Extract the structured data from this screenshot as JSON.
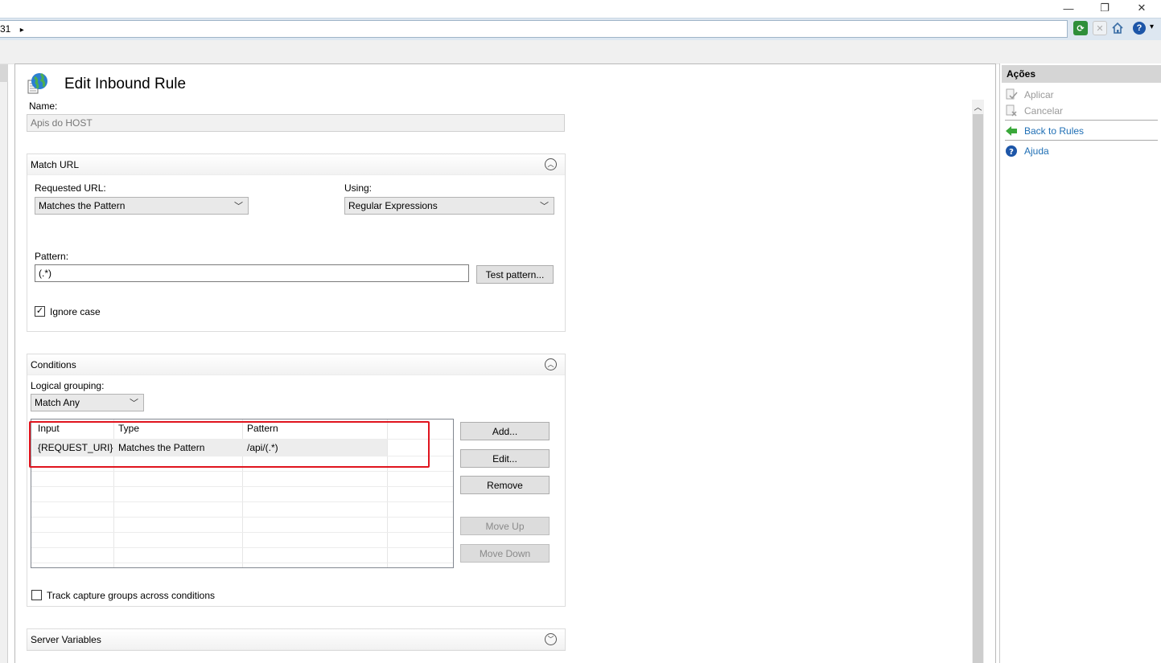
{
  "window": {
    "minimize_glyph": "—",
    "restore_glyph": "❐",
    "close_glyph": "✕"
  },
  "address_bar": {
    "crumb_text": "31",
    "crumb_arrow": "▸"
  },
  "toolbar": {
    "help_menu_arrow": "▾"
  },
  "actions_panel": {
    "title": "Ações",
    "items": [
      {
        "label": "Aplicar",
        "enabled": false
      },
      {
        "label": "Cancelar",
        "enabled": false
      },
      {
        "label": "Back to Rules",
        "enabled": true
      },
      {
        "label": "Ajuda",
        "enabled": true
      }
    ]
  },
  "page": {
    "title": "Edit Inbound Rule"
  },
  "name_field": {
    "label": "Name:",
    "value": "Apis do HOST"
  },
  "match_url": {
    "section_title": "Match URL",
    "requested_url_label": "Requested URL:",
    "requested_url_value": "Matches the Pattern",
    "using_label": "Using:",
    "using_value": "Regular Expressions",
    "pattern_label": "Pattern:",
    "pattern_value": "(.*)",
    "test_pattern_button": "Test pattern...",
    "ignore_case_label": "Ignore case",
    "ignore_case_checked": true
  },
  "conditions": {
    "section_title": "Conditions",
    "logical_grouping_label": "Logical grouping:",
    "logical_grouping_value": "Match Any",
    "columns": [
      "Input",
      "Type",
      "Pattern"
    ],
    "rows": [
      {
        "input": "{REQUEST_URI}",
        "type": "Matches the Pattern",
        "pattern": "/api/(.*)"
      }
    ],
    "buttons": {
      "add": "Add...",
      "edit": "Edit...",
      "remove": "Remove",
      "move_up": "Move Up",
      "move_down": "Move Down"
    },
    "track_capture_label": "Track capture groups across conditions",
    "track_capture_checked": false
  },
  "server_variables": {
    "section_title": "Server Variables"
  },
  "colors": {
    "highlight_box": "#e0141e",
    "link": "#1f6fb5",
    "actions_header": "#d5d5d5"
  }
}
